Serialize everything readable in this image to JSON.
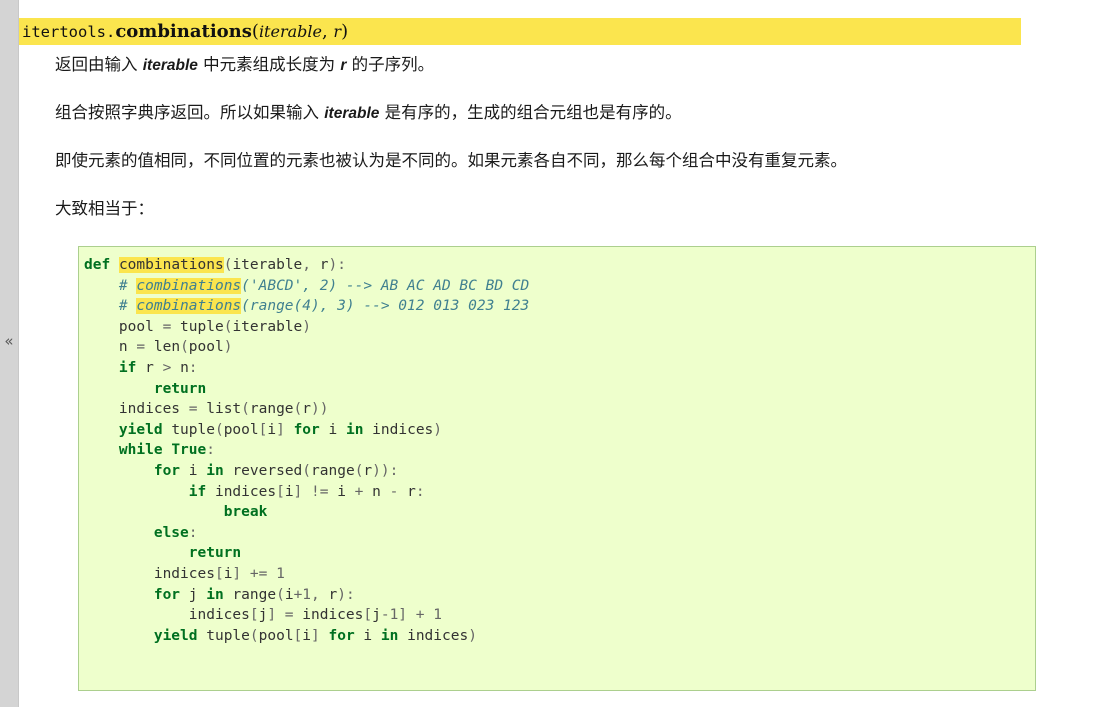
{
  "sidebar": {
    "collapse_icon": "«",
    "collapse_label": "collapse-sidebar"
  },
  "signature": {
    "module_prefix": "itertools.",
    "function_name": "combinations",
    "open_paren": "(",
    "param_1": "iterable",
    "separator": ", ",
    "param_2": "r",
    "close_paren": ")",
    "highlight_color": "#fbe54e"
  },
  "paragraphs": {
    "p1_part1": "返回由输入 ",
    "p1_em1": "iterable",
    "p1_part2": " 中元素组成长度为 ",
    "p1_em2": "r",
    "p1_part3": " 的子序列。",
    "p2_part1": "组合按照字典序返回。所以如果输入 ",
    "p2_em1": "iterable",
    "p2_part2": " 是有序的，生成的组合元组也是有序的。",
    "p3": "即使元素的值相同，不同位置的元素也被认为是不同的。如果元素各自不同，那么每个组合中没有重复元素。",
    "p4": "大致相当于："
  },
  "code": {
    "language": "python",
    "background_color": "#eeffcc",
    "border_color": "#accf8e",
    "keyword_color": "#007020",
    "comment_color": "#408090",
    "highlight_term": "combinations",
    "lines": [
      "def combinations(iterable, r):",
      "    # combinations('ABCD', 2) --> AB AC AD BC BD CD",
      "    # combinations(range(4), 3) --> 012 013 023 123",
      "    pool = tuple(iterable)",
      "    n = len(pool)",
      "    if r > n:",
      "        return",
      "    indices = list(range(r))",
      "    yield tuple(pool[i] for i in indices)",
      "    while True:",
      "        for i in reversed(range(r)):",
      "            if indices[i] != i + n - r:",
      "                break",
      "        else:",
      "            return",
      "        indices[i] += 1",
      "        for j in range(i+1, r):",
      "            indices[j] = indices[j-1] + 1",
      "        yield tuple(pool[i] for i in indices)"
    ]
  }
}
